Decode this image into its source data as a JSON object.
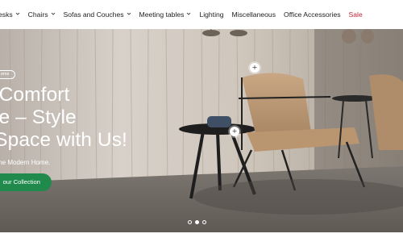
{
  "nav": {
    "items": [
      {
        "label": "esks",
        "has_dropdown": true
      },
      {
        "label": "Chairs",
        "has_dropdown": true
      },
      {
        "label": "Sofas and Couches",
        "has_dropdown": true
      },
      {
        "label": "Meeting tables",
        "has_dropdown": true
      },
      {
        "label": "Lighting",
        "has_dropdown": false
      },
      {
        "label": "Miscellaneous",
        "has_dropdown": false
      },
      {
        "label": "Office Accessories",
        "has_dropdown": false
      },
      {
        "label": "Sale",
        "has_dropdown": false
      }
    ],
    "sale_color": "#c0263a"
  },
  "hero": {
    "badge": "ems",
    "headline_line1": "g Comfort",
    "headline_line2": "me – Style",
    "headline_line3": "r Space with Us!",
    "subline": "the Modern Home.",
    "cta_label": "our Collection",
    "cta_color": "#1f8a4c",
    "hotspot_symbol": "+",
    "slides": {
      "count": 3,
      "active_index": 1
    }
  }
}
